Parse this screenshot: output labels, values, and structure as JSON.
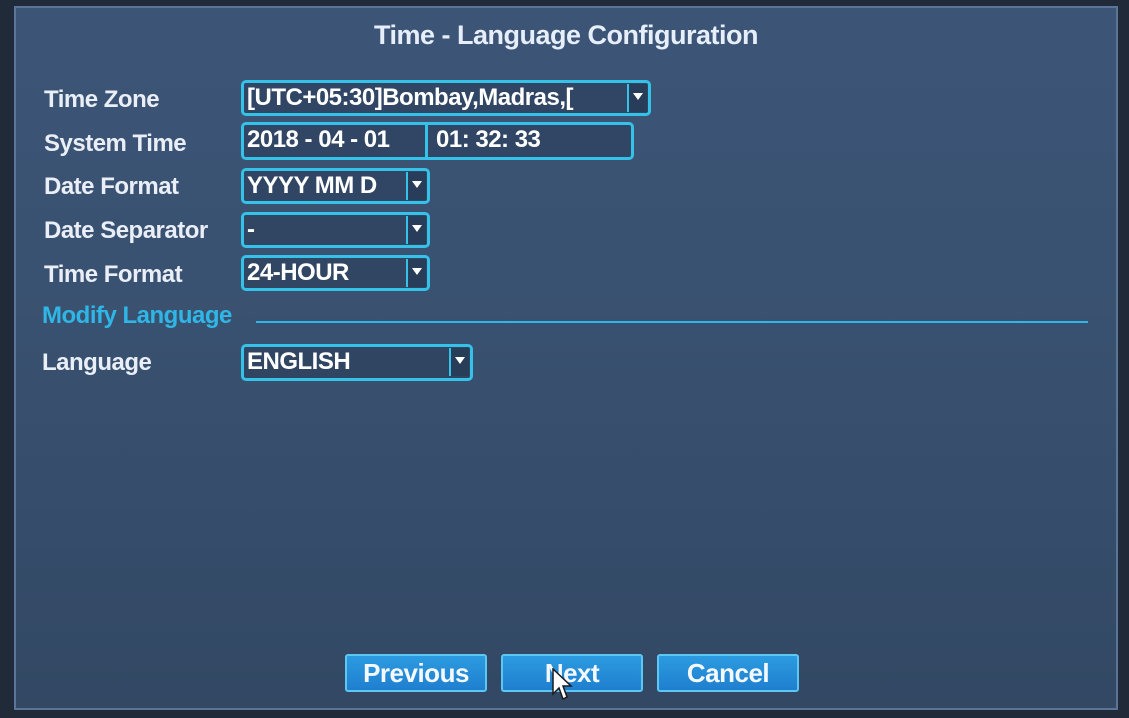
{
  "dialog": {
    "title": "Time - Language Configuration"
  },
  "fields": {
    "time_zone": {
      "label": "Time Zone",
      "value": "[UTC+05:30]Bombay,Madras,["
    },
    "system_time": {
      "label": "System Time",
      "date": "2018 - 04 - 01",
      "time": "01: 32: 33"
    },
    "date_format": {
      "label": "Date Format",
      "value": "YYYY MM D"
    },
    "date_separator": {
      "label": "Date Separator",
      "value": "-"
    },
    "time_format": {
      "label": "Time Format",
      "value": "24-HOUR"
    }
  },
  "language_section": {
    "heading": "Modify Language",
    "language": {
      "label": "Language",
      "value": "ENGLISH"
    }
  },
  "buttons": {
    "previous": "Previous",
    "next": "Next",
    "cancel": "Cancel"
  },
  "colors": {
    "panel_bg": "#3a5271",
    "accent": "#35c2e8",
    "button": "#2c9be0"
  },
  "icons": {
    "dropdown": "chevron-down-icon",
    "cursor": "mouse-pointer-icon"
  }
}
